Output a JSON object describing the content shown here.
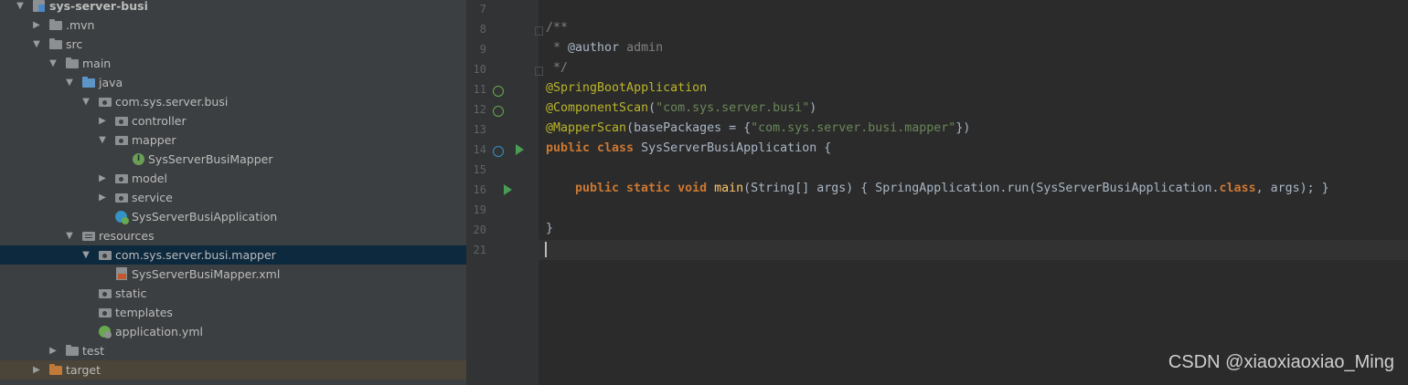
{
  "tree": [
    {
      "label": "sys-server-busi",
      "icon": "project-icon",
      "arrow": "expanded"
    },
    {
      "label": ".mvn",
      "icon": "folder-icon",
      "arrow": "collapsed"
    },
    {
      "label": "src",
      "icon": "folder-icon",
      "arrow": "expanded"
    },
    {
      "label": "main",
      "icon": "folder-icon",
      "arrow": "expanded"
    },
    {
      "label": "java",
      "icon": "source-folder-icon",
      "arrow": "expanded"
    },
    {
      "label": "com.sys.server.busi",
      "icon": "package-icon",
      "arrow": "expanded"
    },
    {
      "label": "controller",
      "icon": "package-icon",
      "arrow": "collapsed"
    },
    {
      "label": "mapper",
      "icon": "package-icon",
      "arrow": "expanded"
    },
    {
      "label": "SysServerBusiMapper",
      "icon": "interface-icon",
      "arrow": ""
    },
    {
      "label": "model",
      "icon": "package-icon",
      "arrow": "collapsed"
    },
    {
      "label": "service",
      "icon": "package-icon",
      "arrow": "collapsed"
    },
    {
      "label": "SysServerBusiApplication",
      "icon": "spring-boot-class-icon",
      "arrow": ""
    },
    {
      "label": "resources",
      "icon": "resources-folder-icon",
      "arrow": "expanded"
    },
    {
      "label": "com.sys.server.busi.mapper",
      "icon": "package-icon",
      "arrow": "expanded"
    },
    {
      "label": "SysServerBusiMapper.xml",
      "icon": "xml-file-icon",
      "arrow": ""
    },
    {
      "label": "static",
      "icon": "package-icon",
      "arrow": ""
    },
    {
      "label": "templates",
      "icon": "package-icon",
      "arrow": ""
    },
    {
      "label": "application.yml",
      "icon": "yml-file-icon",
      "arrow": ""
    },
    {
      "label": "test",
      "icon": "folder-icon",
      "arrow": "collapsed"
    },
    {
      "label": "target",
      "icon": "excluded-folder-icon",
      "arrow": "collapsed"
    }
  ],
  "editor": {
    "line_numbers": [
      "7",
      "8",
      "9",
      "10",
      "11",
      "12",
      "13",
      "14",
      "15",
      "16",
      "19",
      "20",
      "21"
    ],
    "code": {
      "l8": "/**",
      "l9_star": " * ",
      "l9_tag": "@author",
      "l9_val": " admin",
      "l10": " */",
      "l11": "@SpringBootApplication",
      "l12_anno": "@ComponentScan",
      "l12_open": "(",
      "l12_str": "\"com.sys.server.busi\"",
      "l12_close": ")",
      "l13_anno": "@MapperScan",
      "l13_mid": "(basePackages = {",
      "l13_str": "\"com.sys.server.busi.mapper\"",
      "l13_close": "})",
      "l14_kw": "public class ",
      "l14_cls": "SysServerBusiApplication",
      "l14_rest": " {",
      "l16_kw": "public static void ",
      "l16_mth": "main",
      "l16_a": "(",
      "l16_type": "String",
      "l16_b": "[] args) { ",
      "l16_cls": "SpringApplication",
      "l16_c": ".run(",
      "l16_cls2": "SysServerBusiApplication",
      "l16_d": ".",
      "l16_kw2": "class",
      "l16_e": ", args); }",
      "l20": "}"
    }
  },
  "watermark": "CSDN @xiaoxiaoxiao_Ming",
  "colors": {
    "sidebar_bg": "#3c3f41",
    "editor_bg": "#2b2b2b",
    "selection": "#0d293e",
    "annotation": "#bbb529",
    "string": "#6a8759",
    "keyword": "#cc7832"
  }
}
